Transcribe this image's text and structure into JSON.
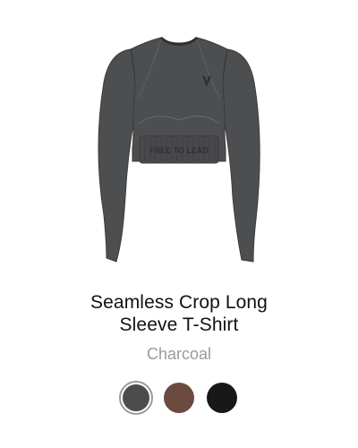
{
  "product": {
    "title_line1": "Seamless Crop Long",
    "title_line2": "Sleeve T-Shirt",
    "color_name": "Charcoal",
    "image_text": "FREE TO LEAD"
  },
  "swatches": [
    {
      "name": "Charcoal",
      "color": "#4b4c4d",
      "selected": true
    },
    {
      "name": "Brown",
      "color": "#6b4a3f",
      "selected": false
    },
    {
      "name": "Black",
      "color": "#1a1718",
      "selected": false
    }
  ],
  "colors": {
    "garment": "#4d4e50",
    "garment_outline": "#3a3b3c",
    "title": "#111111",
    "subtitle": "#9a9a9a"
  }
}
